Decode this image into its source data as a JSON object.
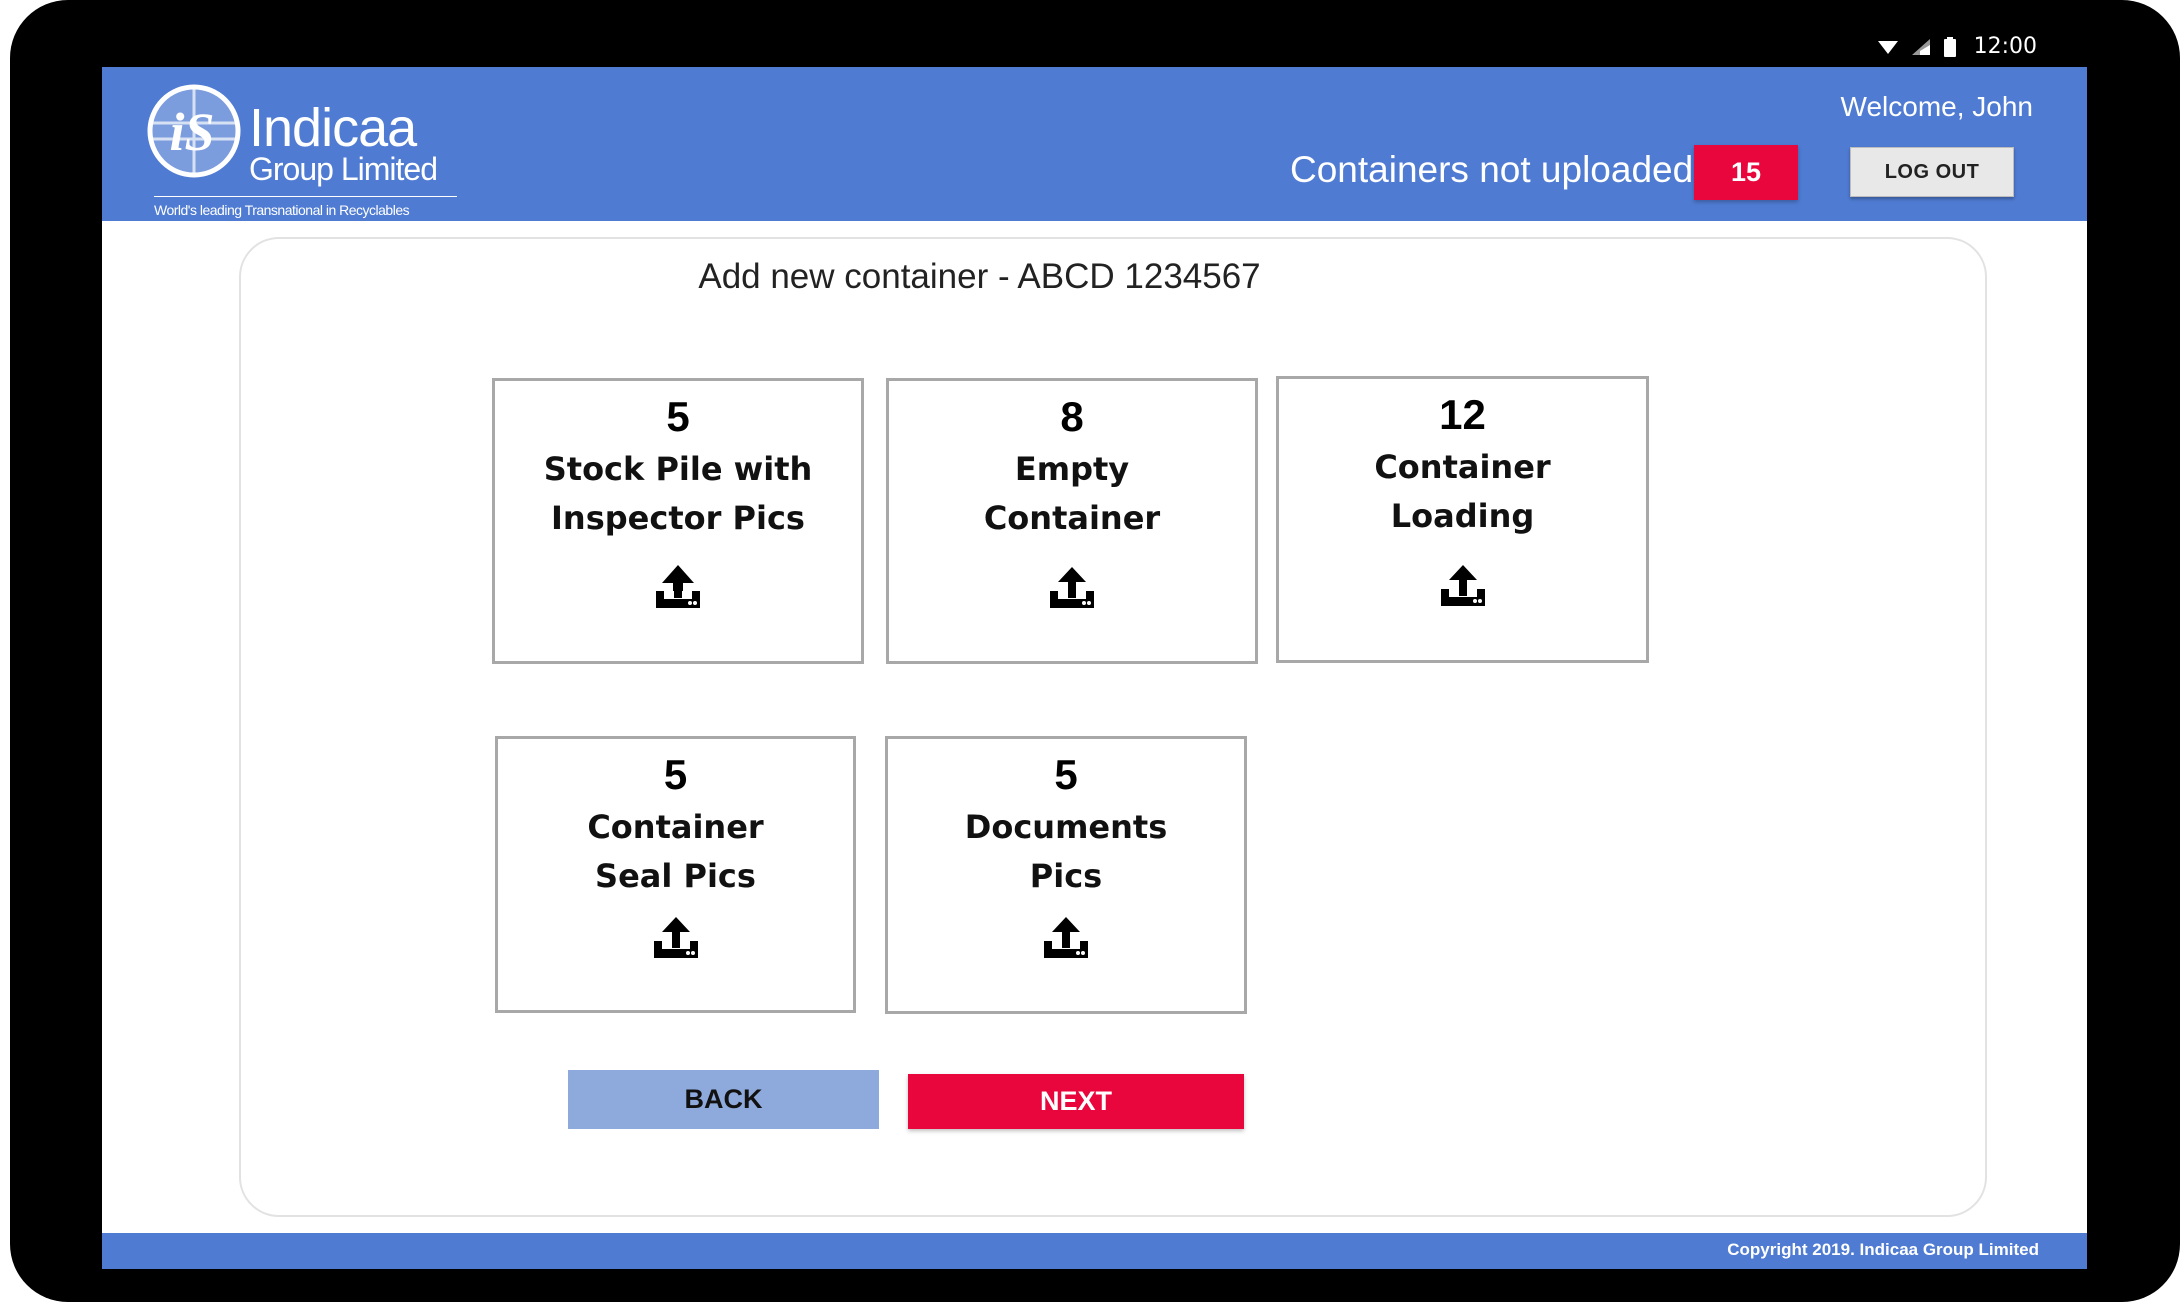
{
  "status_bar": {
    "time": "12:00"
  },
  "header": {
    "logo": {
      "name": "Indicaa",
      "sub": "Group Limited",
      "tagline": "World's leading Transnational in Recyclables"
    },
    "welcome": "Welcome, John",
    "pending_label": "Containers not uploaded",
    "pending_count": "15",
    "logout_label": "LOG OUT"
  },
  "main": {
    "title": "Add new container - ABCD 1234567",
    "tiles": [
      {
        "count": "5",
        "label": "Stock Pile with\nInspector Pics"
      },
      {
        "count": "8",
        "label": "Empty\nContainer"
      },
      {
        "count": "12",
        "label": "Container\nLoading"
      },
      {
        "count": "5",
        "label": "Container\nSeal Pics"
      },
      {
        "count": "5",
        "label": "Documents\nPics"
      }
    ],
    "back_label": "BACK",
    "next_label": "NEXT"
  },
  "footer": {
    "copyright": "Copyright 2019. Indicaa Group Limited"
  },
  "colors": {
    "brand_blue": "#4f7bd2",
    "accent_red": "#e8063c",
    "back_blue": "#8ea9dc"
  },
  "icons": [
    "wifi-icon",
    "signal-icon",
    "battery-icon",
    "upload-icon"
  ]
}
